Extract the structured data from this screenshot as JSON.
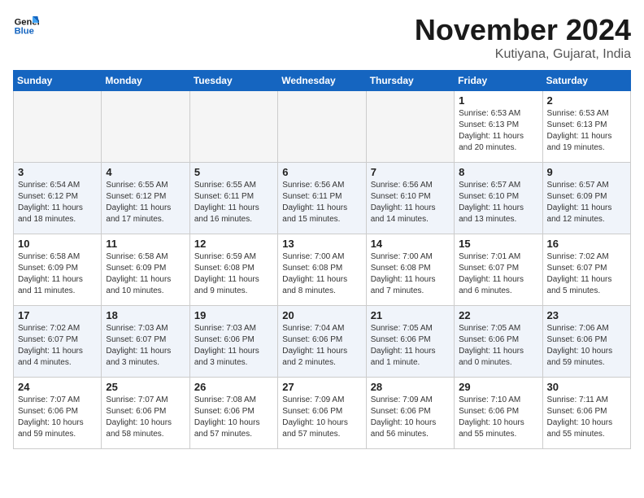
{
  "header": {
    "logo_line1": "General",
    "logo_line2": "Blue",
    "month": "November 2024",
    "location": "Kutiyana, Gujarat, India"
  },
  "weekdays": [
    "Sunday",
    "Monday",
    "Tuesday",
    "Wednesday",
    "Thursday",
    "Friday",
    "Saturday"
  ],
  "weeks": [
    [
      {
        "day": "",
        "info": ""
      },
      {
        "day": "",
        "info": ""
      },
      {
        "day": "",
        "info": ""
      },
      {
        "day": "",
        "info": ""
      },
      {
        "day": "",
        "info": ""
      },
      {
        "day": "1",
        "info": "Sunrise: 6:53 AM\nSunset: 6:13 PM\nDaylight: 11 hours\nand 20 minutes."
      },
      {
        "day": "2",
        "info": "Sunrise: 6:53 AM\nSunset: 6:13 PM\nDaylight: 11 hours\nand 19 minutes."
      }
    ],
    [
      {
        "day": "3",
        "info": "Sunrise: 6:54 AM\nSunset: 6:12 PM\nDaylight: 11 hours\nand 18 minutes."
      },
      {
        "day": "4",
        "info": "Sunrise: 6:55 AM\nSunset: 6:12 PM\nDaylight: 11 hours\nand 17 minutes."
      },
      {
        "day": "5",
        "info": "Sunrise: 6:55 AM\nSunset: 6:11 PM\nDaylight: 11 hours\nand 16 minutes."
      },
      {
        "day": "6",
        "info": "Sunrise: 6:56 AM\nSunset: 6:11 PM\nDaylight: 11 hours\nand 15 minutes."
      },
      {
        "day": "7",
        "info": "Sunrise: 6:56 AM\nSunset: 6:10 PM\nDaylight: 11 hours\nand 14 minutes."
      },
      {
        "day": "8",
        "info": "Sunrise: 6:57 AM\nSunset: 6:10 PM\nDaylight: 11 hours\nand 13 minutes."
      },
      {
        "day": "9",
        "info": "Sunrise: 6:57 AM\nSunset: 6:09 PM\nDaylight: 11 hours\nand 12 minutes."
      }
    ],
    [
      {
        "day": "10",
        "info": "Sunrise: 6:58 AM\nSunset: 6:09 PM\nDaylight: 11 hours\nand 11 minutes."
      },
      {
        "day": "11",
        "info": "Sunrise: 6:58 AM\nSunset: 6:09 PM\nDaylight: 11 hours\nand 10 minutes."
      },
      {
        "day": "12",
        "info": "Sunrise: 6:59 AM\nSunset: 6:08 PM\nDaylight: 11 hours\nand 9 minutes."
      },
      {
        "day": "13",
        "info": "Sunrise: 7:00 AM\nSunset: 6:08 PM\nDaylight: 11 hours\nand 8 minutes."
      },
      {
        "day": "14",
        "info": "Sunrise: 7:00 AM\nSunset: 6:08 PM\nDaylight: 11 hours\nand 7 minutes."
      },
      {
        "day": "15",
        "info": "Sunrise: 7:01 AM\nSunset: 6:07 PM\nDaylight: 11 hours\nand 6 minutes."
      },
      {
        "day": "16",
        "info": "Sunrise: 7:02 AM\nSunset: 6:07 PM\nDaylight: 11 hours\nand 5 minutes."
      }
    ],
    [
      {
        "day": "17",
        "info": "Sunrise: 7:02 AM\nSunset: 6:07 PM\nDaylight: 11 hours\nand 4 minutes."
      },
      {
        "day": "18",
        "info": "Sunrise: 7:03 AM\nSunset: 6:07 PM\nDaylight: 11 hours\nand 3 minutes."
      },
      {
        "day": "19",
        "info": "Sunrise: 7:03 AM\nSunset: 6:06 PM\nDaylight: 11 hours\nand 3 minutes."
      },
      {
        "day": "20",
        "info": "Sunrise: 7:04 AM\nSunset: 6:06 PM\nDaylight: 11 hours\nand 2 minutes."
      },
      {
        "day": "21",
        "info": "Sunrise: 7:05 AM\nSunset: 6:06 PM\nDaylight: 11 hours\nand 1 minute."
      },
      {
        "day": "22",
        "info": "Sunrise: 7:05 AM\nSunset: 6:06 PM\nDaylight: 11 hours\nand 0 minutes."
      },
      {
        "day": "23",
        "info": "Sunrise: 7:06 AM\nSunset: 6:06 PM\nDaylight: 10 hours\nand 59 minutes."
      }
    ],
    [
      {
        "day": "24",
        "info": "Sunrise: 7:07 AM\nSunset: 6:06 PM\nDaylight: 10 hours\nand 59 minutes."
      },
      {
        "day": "25",
        "info": "Sunrise: 7:07 AM\nSunset: 6:06 PM\nDaylight: 10 hours\nand 58 minutes."
      },
      {
        "day": "26",
        "info": "Sunrise: 7:08 AM\nSunset: 6:06 PM\nDaylight: 10 hours\nand 57 minutes."
      },
      {
        "day": "27",
        "info": "Sunrise: 7:09 AM\nSunset: 6:06 PM\nDaylight: 10 hours\nand 57 minutes."
      },
      {
        "day": "28",
        "info": "Sunrise: 7:09 AM\nSunset: 6:06 PM\nDaylight: 10 hours\nand 56 minutes."
      },
      {
        "day": "29",
        "info": "Sunrise: 7:10 AM\nSunset: 6:06 PM\nDaylight: 10 hours\nand 55 minutes."
      },
      {
        "day": "30",
        "info": "Sunrise: 7:11 AM\nSunset: 6:06 PM\nDaylight: 10 hours\nand 55 minutes."
      }
    ]
  ]
}
